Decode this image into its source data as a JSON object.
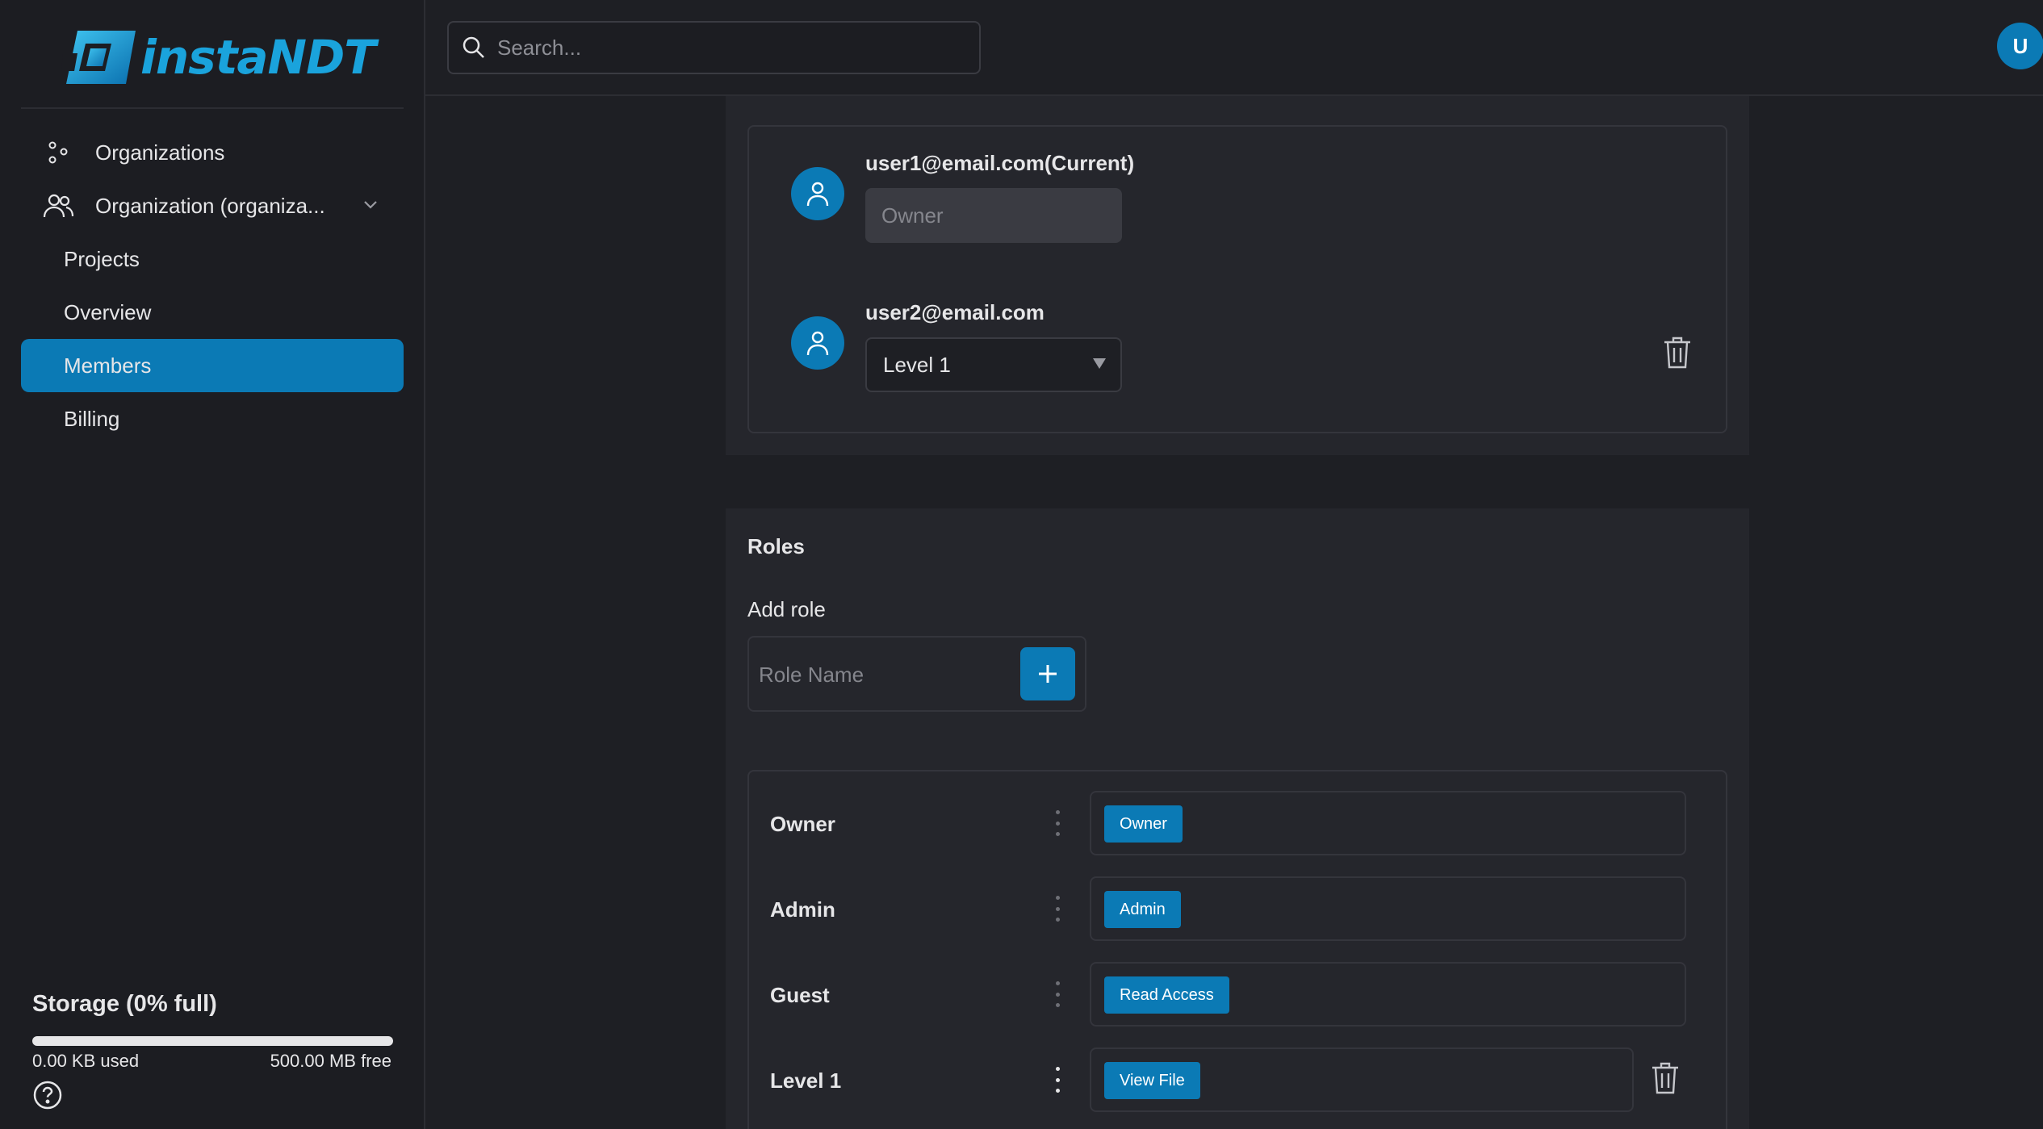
{
  "app": {
    "logo_text": "instaNDT",
    "brand_color": "#0b7ab5"
  },
  "sidebar": {
    "items": [
      {
        "label": "Organizations",
        "icon": "organizations-icon"
      },
      {
        "label": "Organization (organiza...",
        "icon": "users-icon"
      },
      {
        "label": "Projects"
      },
      {
        "label": "Overview"
      },
      {
        "label": "Members",
        "active": true
      },
      {
        "label": "Billing"
      }
    ],
    "storage": {
      "title": "Storage (0% full)",
      "used": "0.00 KB used",
      "free": "500.00 MB free",
      "fraction_used": 0
    }
  },
  "header": {
    "search_placeholder": "Search...",
    "avatar_initial": "U"
  },
  "members": {
    "list": [
      {
        "email": "user1@email.com(Current)",
        "role": "Owner",
        "editable": false
      },
      {
        "email": "user2@email.com",
        "role": "Level 1",
        "editable": true
      }
    ]
  },
  "roles": {
    "title": "Roles",
    "add_label": "Add role",
    "input_placeholder": "Role Name",
    "list": [
      {
        "name": "Owner",
        "permission": "Owner"
      },
      {
        "name": "Admin",
        "permission": "Admin"
      },
      {
        "name": "Guest",
        "permission": "Read Access"
      },
      {
        "name": "Level 1",
        "permission": "View File"
      }
    ]
  }
}
